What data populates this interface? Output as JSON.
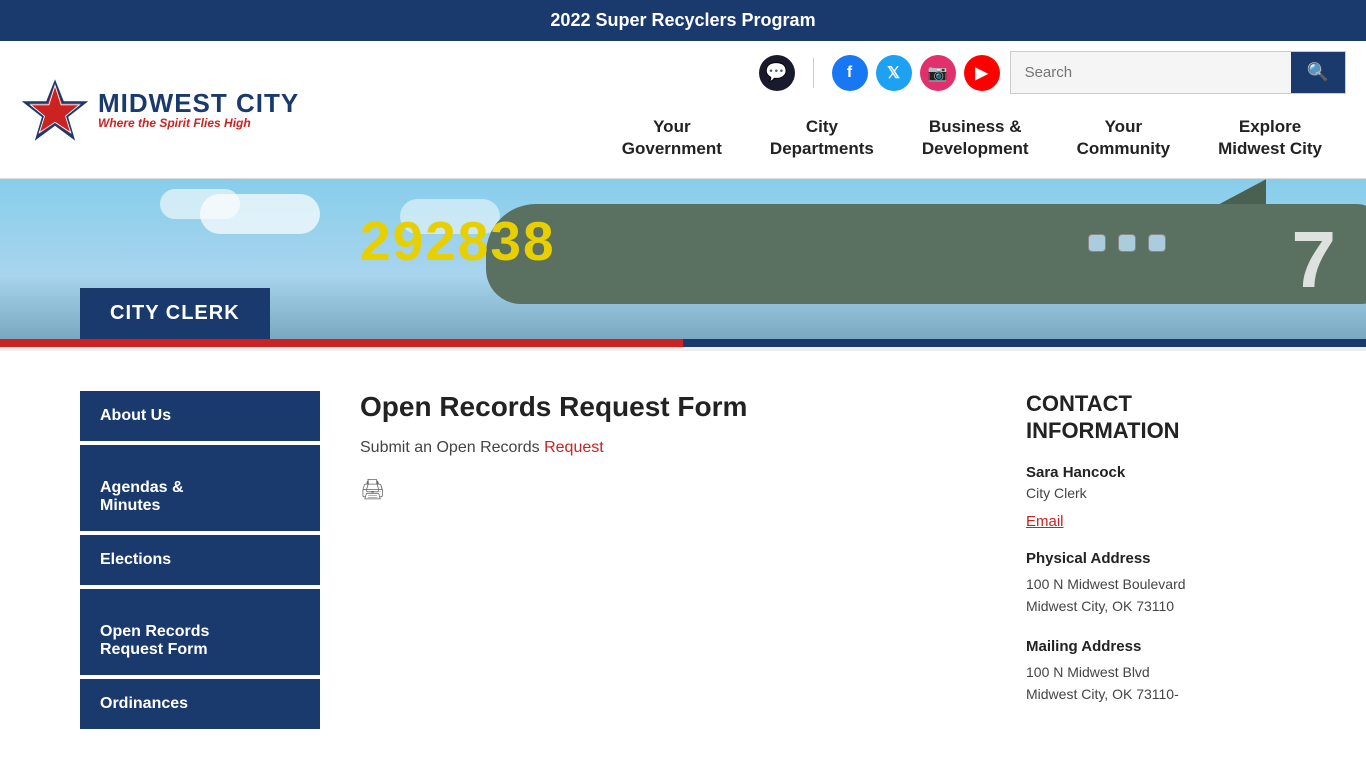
{
  "banner": {
    "text": "2022 Super Recyclers Program"
  },
  "header": {
    "logo": {
      "title": "MIDWEST CITY",
      "subtitle": "Where the Spirit Flies High"
    },
    "social": {
      "facebook_label": "f",
      "twitter_label": "t",
      "instagram_label": "in",
      "youtube_label": "▶"
    },
    "search": {
      "placeholder": "Search",
      "button_icon": "🔍"
    },
    "nav": [
      {
        "id": "your-government",
        "label": "Your\nGovernment"
      },
      {
        "id": "city-departments",
        "label": "City\nDepartments"
      },
      {
        "id": "business-development",
        "label": "Business &\nDevelopment"
      },
      {
        "id": "your-community",
        "label": "Your\nCommunity"
      },
      {
        "id": "explore",
        "label": "Explore\nMidwest City"
      }
    ]
  },
  "hero": {
    "badge_text": "CITY CLERK",
    "plane_number": "292838"
  },
  "sidebar": {
    "items": [
      {
        "id": "about-us",
        "label": "About Us",
        "active": false
      },
      {
        "id": "agendas-minutes",
        "label": "Agendas &\nMinutes",
        "active": false
      },
      {
        "id": "elections",
        "label": "Elections",
        "active": false
      },
      {
        "id": "open-records",
        "label": "Open Records\nRequest Form",
        "active": true
      },
      {
        "id": "ordinances",
        "label": "Ordinances",
        "active": false
      }
    ]
  },
  "main": {
    "page_title": "Open Records Request Form",
    "subtitle_text": "Submit an Open Records ",
    "subtitle_link": "Request"
  },
  "contact": {
    "section_title": "CONTACT\nINFORMATION",
    "name": "Sara Hancock",
    "role": "City Clerk",
    "email_label": "Email",
    "physical_address_label": "Physical Address",
    "physical_address_line1": "100 N Midwest Boulevard",
    "physical_address_line2": "Midwest City, OK 73110",
    "mailing_address_label": "Mailing Address",
    "mailing_address_line1": "100 N Midwest Blvd",
    "mailing_address_line2": "Midwest City, OK 73110-"
  }
}
